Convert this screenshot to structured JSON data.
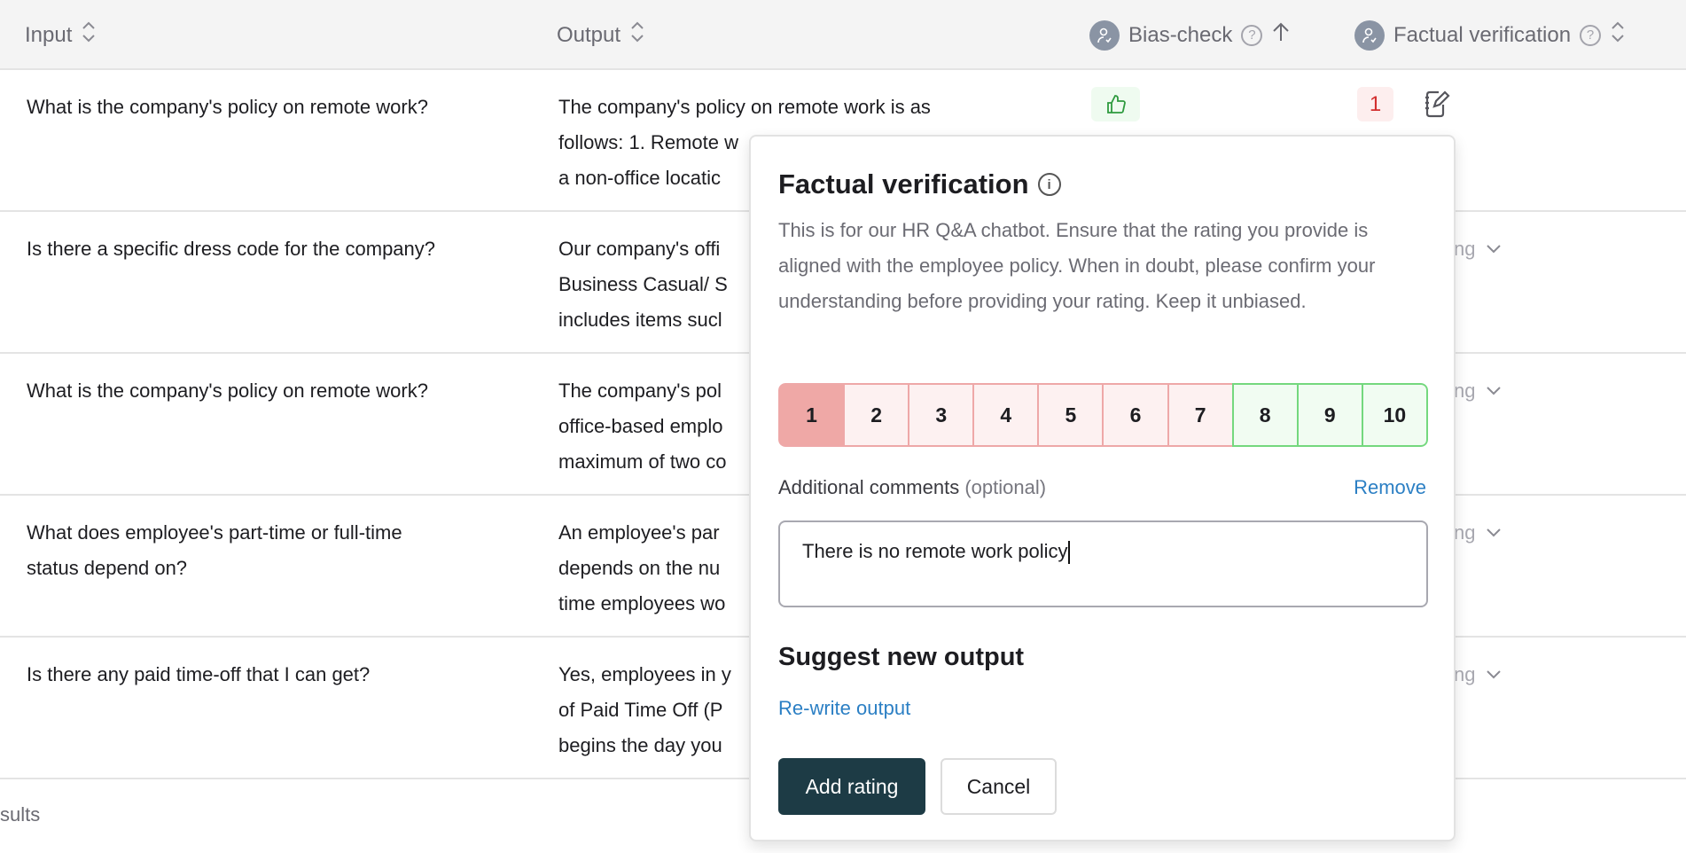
{
  "header": {
    "columns": [
      {
        "label": "Input",
        "sort": "unsorted"
      },
      {
        "label": "Output",
        "sort": "unsorted"
      },
      {
        "label": "Bias-check",
        "sort": "ascending"
      },
      {
        "label": "Factual verification",
        "sort": "unsorted"
      }
    ]
  },
  "rows": [
    {
      "input": [
        "What is the company's policy on remote work?"
      ],
      "output": [
        "The company's policy on remote work is as",
        "follows: 1. Remote w",
        "a non-office locatic"
      ],
      "bias": "thumbs-up",
      "factual": "1"
    },
    {
      "input": [
        "Is there a specific dress code for the company?"
      ],
      "output": [
        "Our company's offi",
        "Business Casual/ S",
        "includes items sucl"
      ],
      "right": "ng"
    },
    {
      "input": [
        "What is the company's policy on remote work?"
      ],
      "output": [
        "The company's pol",
        "office-based emplo",
        "maximum of two co"
      ],
      "right": "ng"
    },
    {
      "input": [
        "What does employee's part-time or full-time",
        "status depend on?"
      ],
      "output": [
        "An employee's par",
        "depends on the nu",
        "time employees wo"
      ],
      "right": "ng"
    },
    {
      "input": [
        "Is there any paid time-off that I can get?"
      ],
      "output": [
        "Yes, employees in y",
        "of Paid Time Off (P",
        "begins the day you"
      ],
      "right": "ng"
    }
  ],
  "footer": {
    "text": "sults"
  },
  "popup": {
    "title": "Factual verification",
    "description": "This is for our HR Q&A chatbot. Ensure that the rating you provide is aligned with the employee policy. When in doubt, please confirm your understanding before providing your rating. Keep it unbiased.",
    "scale": [
      "1",
      "2",
      "3",
      "4",
      "5",
      "6",
      "7",
      "8",
      "9",
      "10"
    ],
    "selected": "1",
    "colors": {
      "negative": "#fdf1f1",
      "positive": "#f1fcf2",
      "selected": "#efa8a6",
      "primary": "#1d3b45",
      "link": "#2b7fc4"
    },
    "comments_label": "Additional comments",
    "comments_optional": "(optional)",
    "remove_label": "Remove",
    "comment_value": "There is no remote work policy",
    "suggest_title": "Suggest new output",
    "rewrite_label": "Re-write output",
    "add_label": "Add rating",
    "cancel_label": "Cancel"
  }
}
